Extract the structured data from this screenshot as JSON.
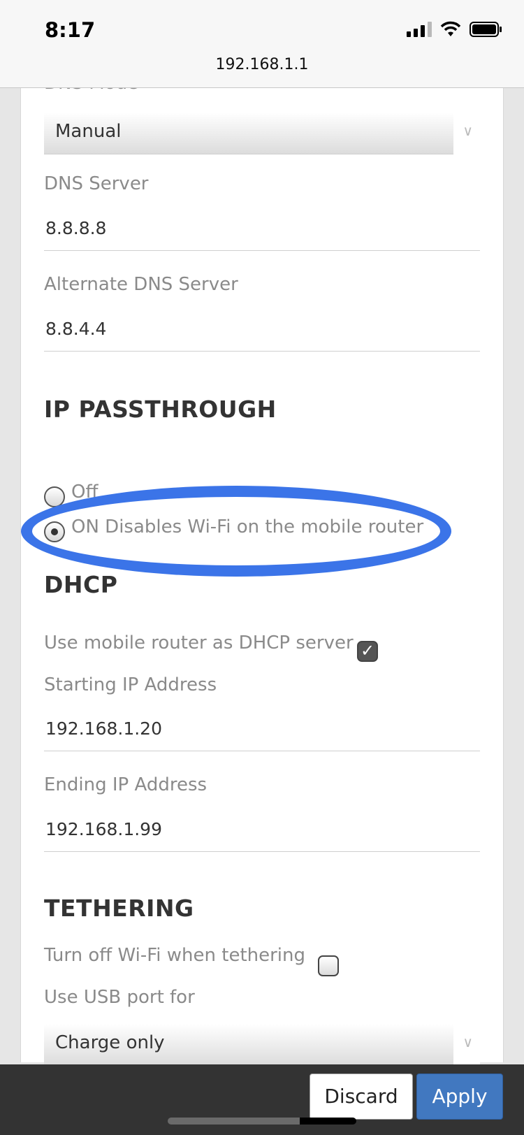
{
  "status_bar": {
    "time": "8:17",
    "signal_icon": "cellular-signal-icon",
    "wifi_icon": "wifi-icon",
    "battery_icon": "battery-icon"
  },
  "browser": {
    "url": "192.168.1.1"
  },
  "dns": {
    "mode_label": "DNS Mode",
    "mode_value": "Manual",
    "server_label": "DNS Server",
    "server_value": "8.8.8.8",
    "alt_server_label": "Alternate DNS Server",
    "alt_server_value": "8.8.4.4"
  },
  "ip_passthrough": {
    "title": "IP PASSTHROUGH",
    "options": [
      {
        "label": "Off",
        "selected": false
      },
      {
        "label": "ON Disables Wi-Fi on the mobile router",
        "selected": true
      }
    ],
    "highlight_color": "#3b74e8"
  },
  "dhcp": {
    "title": "DHCP",
    "use_router_label": "Use mobile router as DHCP server",
    "use_router_checked": true,
    "start_label": "Starting IP Address",
    "start_value": "192.168.1.20",
    "end_label": "Ending IP Address",
    "end_value": "192.168.1.99"
  },
  "tethering": {
    "title": "TETHERING",
    "wifi_off_label": "Turn off Wi-Fi when tethering",
    "wifi_off_checked": false,
    "usb_label": "Use USB port for",
    "usb_value": "Charge only"
  },
  "actions": {
    "discard_label": "Discard",
    "apply_label": "Apply",
    "apply_color": "#4178c0"
  }
}
